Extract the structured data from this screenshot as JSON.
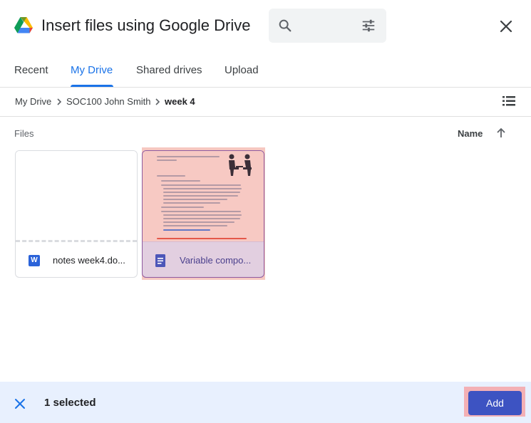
{
  "dialog": {
    "title": "Insert files using Google Drive",
    "close_icon": "close-icon",
    "logo_icon": "google-drive-logo"
  },
  "search": {
    "placeholder": "",
    "value": "",
    "search_icon": "search-icon",
    "options_icon": "tune-icon"
  },
  "tabs": [
    {
      "label": "Recent",
      "active": false
    },
    {
      "label": "My Drive",
      "active": true
    },
    {
      "label": "Shared drives",
      "active": false
    },
    {
      "label": "Upload",
      "active": false
    }
  ],
  "breadcrumb": {
    "items": [
      "My Drive",
      "SOC100 John Smith",
      "week 4"
    ],
    "view_icon": "list-view-icon"
  },
  "files_section": {
    "label": "Files",
    "sort_label": "Name",
    "sort_icon": "arrow-upward-icon"
  },
  "files": [
    {
      "name": "notes week4.do...",
      "type_icon": "word-icon",
      "type_letter": "W",
      "selected": false
    },
    {
      "name": "Variable compo...",
      "type_icon": "google-docs-icon",
      "selected": true
    }
  ],
  "selection_bar": {
    "selected_text": "1 selected",
    "add_label": "Add",
    "clear_icon": "close-icon"
  },
  "colors": {
    "accent": "#1a73e8",
    "add_button": "#3d53c2",
    "selection_bar_bg": "#e8f0fe"
  }
}
